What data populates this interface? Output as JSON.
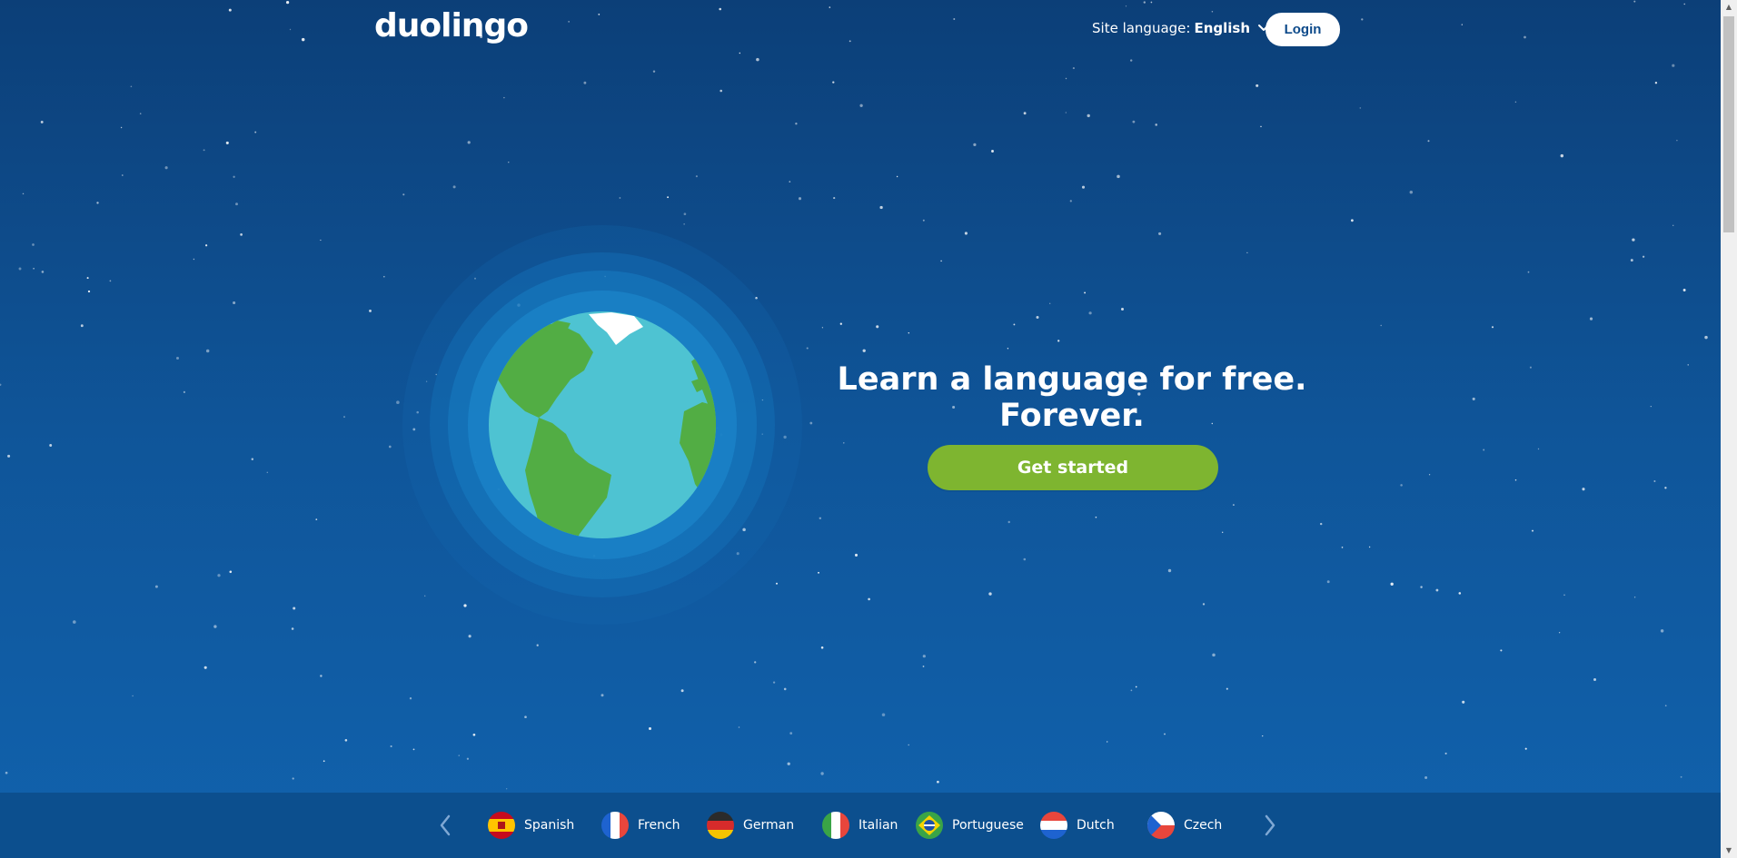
{
  "header": {
    "logo_text": "duolingo",
    "site_language_label": "Site language:",
    "site_language_value": "English",
    "login_label": "Login"
  },
  "hero": {
    "tagline": "Learn a language for free. Forever.",
    "cta_label": "Get started"
  },
  "courses": [
    {
      "label": "Spanish",
      "flag": "spain-flag-icon"
    },
    {
      "label": "French",
      "flag": "france-flag-icon"
    },
    {
      "label": "German",
      "flag": "germany-flag-icon"
    },
    {
      "label": "Italian",
      "flag": "italy-flag-icon"
    },
    {
      "label": "Portuguese",
      "flag": "brazil-flag-icon"
    },
    {
      "label": "Dutch",
      "flag": "netherlands-flag-icon"
    },
    {
      "label": "Czech",
      "flag": "czech-flag-icon"
    }
  ],
  "colors": {
    "background_top": "#0c3f78",
    "background_bottom": "#1162ad",
    "cta_green": "#7eb530",
    "course_bar": "#0c4f8e"
  },
  "icons": {
    "prev": "chevron-left-icon",
    "next": "chevron-right-icon",
    "dropdown": "chevron-down-icon"
  }
}
